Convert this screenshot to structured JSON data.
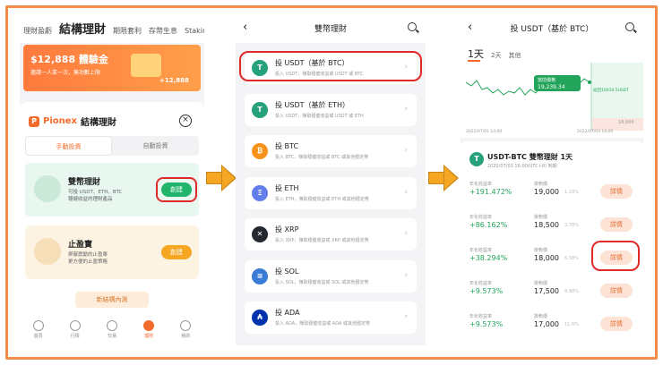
{
  "screen1": {
    "tabs": [
      "理財盈虧",
      "結構理財",
      "期限套利",
      "存幣生息",
      "Staking"
    ],
    "banner": {
      "title": "$12,888 體驗金",
      "desc": "邀請一人拿一次，無功數上限",
      "amount": "+12,888"
    },
    "logo": {
      "brand": "Pionex",
      "subtitle": "結構理財"
    },
    "segments": [
      "手動投資",
      "自動投資"
    ],
    "cards": [
      {
        "title": "雙幣理財",
        "desc1": "可投 USDT、ETH、BTC",
        "desc2": "穩健收益的理財產品",
        "button": "創建"
      },
      {
        "title": "止盈寶",
        "desc1": "屏蔽震動的止盈單",
        "desc2": "更方便的止盈策略",
        "button": "創建"
      }
    ],
    "new_button": "新結構內測",
    "nav": [
      "首頁",
      "行情",
      "交易",
      "理財",
      "我的"
    ]
  },
  "screen2": {
    "title": "雙幣理財",
    "products": [
      {
        "name": "投 USDT（基於 BTC）",
        "desc": "投入 USDT，賺取穩健收益或 USDT 或 BTC",
        "icon": "T",
        "color": "#26a17b"
      },
      {
        "name": "投 USDT（基於 ETH）",
        "desc": "投入 USDT，賺取穩健收益或 USDT 或 ETH",
        "icon": "T",
        "color": "#26a17b"
      },
      {
        "name": "投 BTC",
        "desc": "投入 BTC，賺取穩健收益或 BTC 或其他穩定幣",
        "icon": "₿",
        "color": "#f7931a"
      },
      {
        "name": "投 ETH",
        "desc": "投入 ETH，賺取穩健收益或 ETH 或其他穩定幣",
        "icon": "Ξ",
        "color": "#627eea"
      },
      {
        "name": "投 XRP",
        "desc": "投入 XRP，賺取穩健收益或 XRP 或其他穩定幣",
        "icon": "✕",
        "color": "#23292f"
      },
      {
        "name": "投 SOL",
        "desc": "投入 SOL，賺取穩健收益或 SOL 或其他穩定幣",
        "icon": "≡",
        "color": "#3a7bd5"
      },
      {
        "name": "投 ADA",
        "desc": "投入 ADA，賺取穩健收益或 ADA 或其他穩定幣",
        "icon": "₳",
        "color": "#0033ad"
      }
    ]
  },
  "screen3": {
    "title": "投 USDT（基於 BTC）",
    "ranges": [
      "1天",
      "2天",
      "其他"
    ],
    "chart": {
      "current_label": "當前價格",
      "current_value": "19,239.34",
      "right_label": "返回10010.5USDT",
      "right_value": "18,000",
      "date_left": "2022/07/01 14:00",
      "date_right": "2022/07/03 16:00"
    },
    "product_name": "USDT-BTC 雙幣理財 1天",
    "product_sub": "2022/07/03 16:00(UTC+8) 到期",
    "apy_label": "年化收益率",
    "price_label": "掛鉤價",
    "detail_label": "詳情",
    "rows": [
      {
        "apy": "+191.472%",
        "price": "19,000",
        "pct": "1.18%"
      },
      {
        "apy": "+86.162%",
        "price": "18,500",
        "pct": "3.78%"
      },
      {
        "apy": "+38.294%",
        "price": "18,000",
        "pct": "6.38%"
      },
      {
        "apy": "+9.573%",
        "price": "17,500",
        "pct": "8.98%"
      },
      {
        "apy": "+9.573%",
        "price": "17,000",
        "pct": "11.6%"
      }
    ]
  }
}
